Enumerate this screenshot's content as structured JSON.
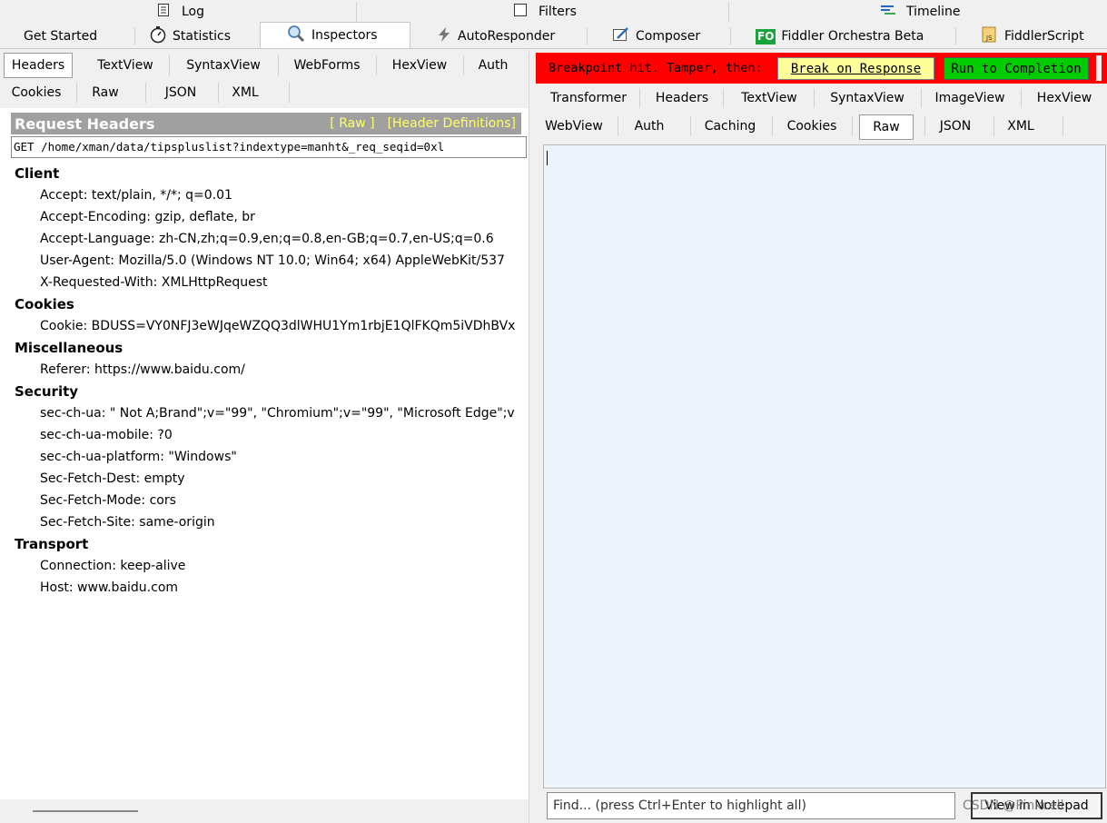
{
  "top_tabs": {
    "log": "Log",
    "filters": "Filters",
    "timeline": "Timeline"
  },
  "main_tabs": [
    {
      "label": "Get Started"
    },
    {
      "label": "Statistics"
    },
    {
      "label": "Inspectors"
    },
    {
      "label": "AutoResponder"
    },
    {
      "label": "Composer"
    },
    {
      "label": "Fiddler Orchestra Beta",
      "icon_text": "FO"
    },
    {
      "label": "FiddlerScript"
    }
  ],
  "request": {
    "tabs_row1": [
      "Headers",
      "TextView",
      "SyntaxView",
      "WebForms",
      "HexView",
      "Auth"
    ],
    "tabs_row2": [
      "Cookies",
      "Raw",
      "JSON",
      "XML"
    ],
    "active_tab": "Headers",
    "panel_title": "Request Headers",
    "raw_link": "[ Raw ]",
    "defs_link": "[Header Definitions]",
    "request_line": "GET /home/xman/data/tipspluslist?indextype=manht&_req_seqid=0xl",
    "groups": [
      {
        "name": "Client",
        "headers": [
          "Accept: text/plain, */*; q=0.01",
          "Accept-Encoding: gzip, deflate, br",
          "Accept-Language: zh-CN,zh;q=0.9,en;q=0.8,en-GB;q=0.7,en-US;q=0.6",
          "User-Agent: Mozilla/5.0 (Windows NT 10.0; Win64; x64) AppleWebKit/537",
          "X-Requested-With: XMLHttpRequest"
        ]
      },
      {
        "name": "Cookies",
        "headers": [
          "Cookie: BDUSS=VY0NFJ3eWJqeWZQQ3dlWHU1Ym1rbjE1QlFKQm5iVDhBVx"
        ]
      },
      {
        "name": "Miscellaneous",
        "headers": [
          "Referer: https://www.baidu.com/"
        ]
      },
      {
        "name": "Security",
        "headers": [
          "sec-ch-ua: \" Not A;Brand\";v=\"99\", \"Chromium\";v=\"99\", \"Microsoft Edge\";v",
          "sec-ch-ua-mobile: ?0",
          "sec-ch-ua-platform: \"Windows\"",
          "Sec-Fetch-Dest: empty",
          "Sec-Fetch-Mode: cors",
          "Sec-Fetch-Site: same-origin"
        ]
      },
      {
        "name": "Transport",
        "headers": [
          "Connection: keep-alive",
          "Host: www.baidu.com"
        ]
      }
    ]
  },
  "breakpoint": {
    "message": "Breakpoint hit. Tamper, then:",
    "break_on_response": "Break on Response",
    "run_to_completion": "Run to Completion"
  },
  "response": {
    "tabs_row1": [
      "Transformer",
      "Headers",
      "TextView",
      "SyntaxView",
      "ImageView",
      "HexView"
    ],
    "tabs_row2": [
      "WebView",
      "Auth",
      "Caching",
      "Cookies",
      "Raw",
      "JSON",
      "XML"
    ],
    "active_tab": "Raw",
    "find_placeholder": "Find... (press Ctrl+Enter to highlight all)",
    "view_notepad": "View in Notepad",
    "watermark": "CSDN @Pinkcell"
  },
  "colors": {
    "breakpoint_bar": "#ff0000",
    "break_button": "#ffff99",
    "run_button": "#00cc00",
    "header_bar": "#a0a0a0",
    "header_links": "#ffff66",
    "editor_bg": "#eef4fc"
  }
}
